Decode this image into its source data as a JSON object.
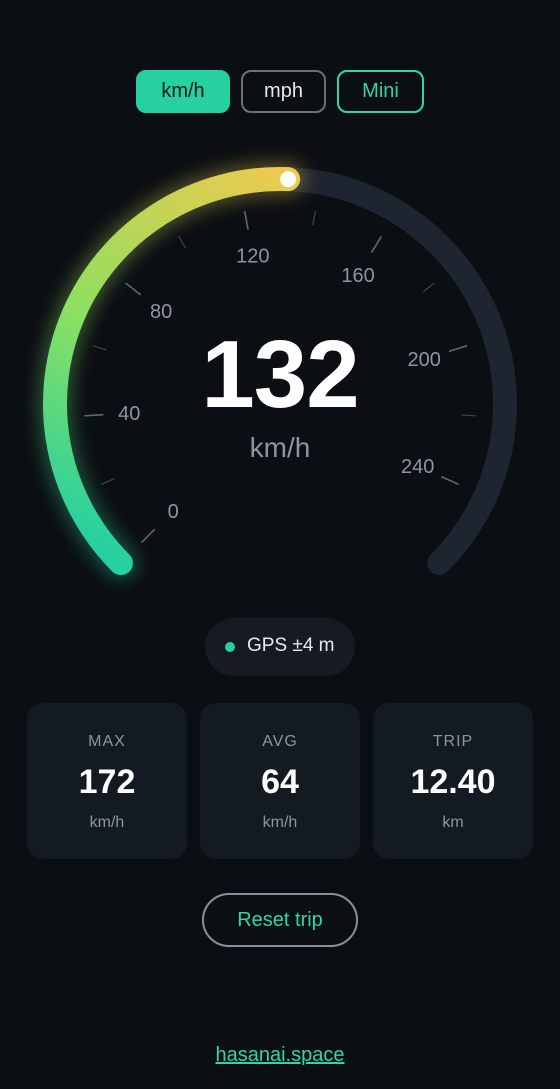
{
  "units": {
    "kmh_label": "km/h",
    "mph_label": "mph",
    "mini_label": "Mini",
    "selected": "km/h"
  },
  "speedometer": {
    "value": "132",
    "unit": "km/h",
    "speed": 132,
    "max_scale": 260,
    "tick_labels": [
      "0",
      "40",
      "80",
      "120",
      "160",
      "200",
      "240"
    ],
    "active_color_start": "#26d0a0",
    "active_color_mid": "#8de060",
    "active_color_end": "#f2c94c",
    "track_color": "#1e2530"
  },
  "gps": {
    "label": "GPS ±4 m",
    "status_color": "#26d0a0"
  },
  "stats": {
    "max": {
      "label": "MAX",
      "value": "172",
      "unit": "km/h"
    },
    "avg": {
      "label": "AVG",
      "value": "64",
      "unit": "km/h"
    },
    "trip": {
      "label": "TRIP",
      "value": "12.40",
      "unit": "km"
    }
  },
  "reset_label": "Reset trip",
  "footer_link": "hasanai.space",
  "colors": {
    "accent": "#26d0a0",
    "background": "#0b0e12",
    "card": "#141a22"
  }
}
